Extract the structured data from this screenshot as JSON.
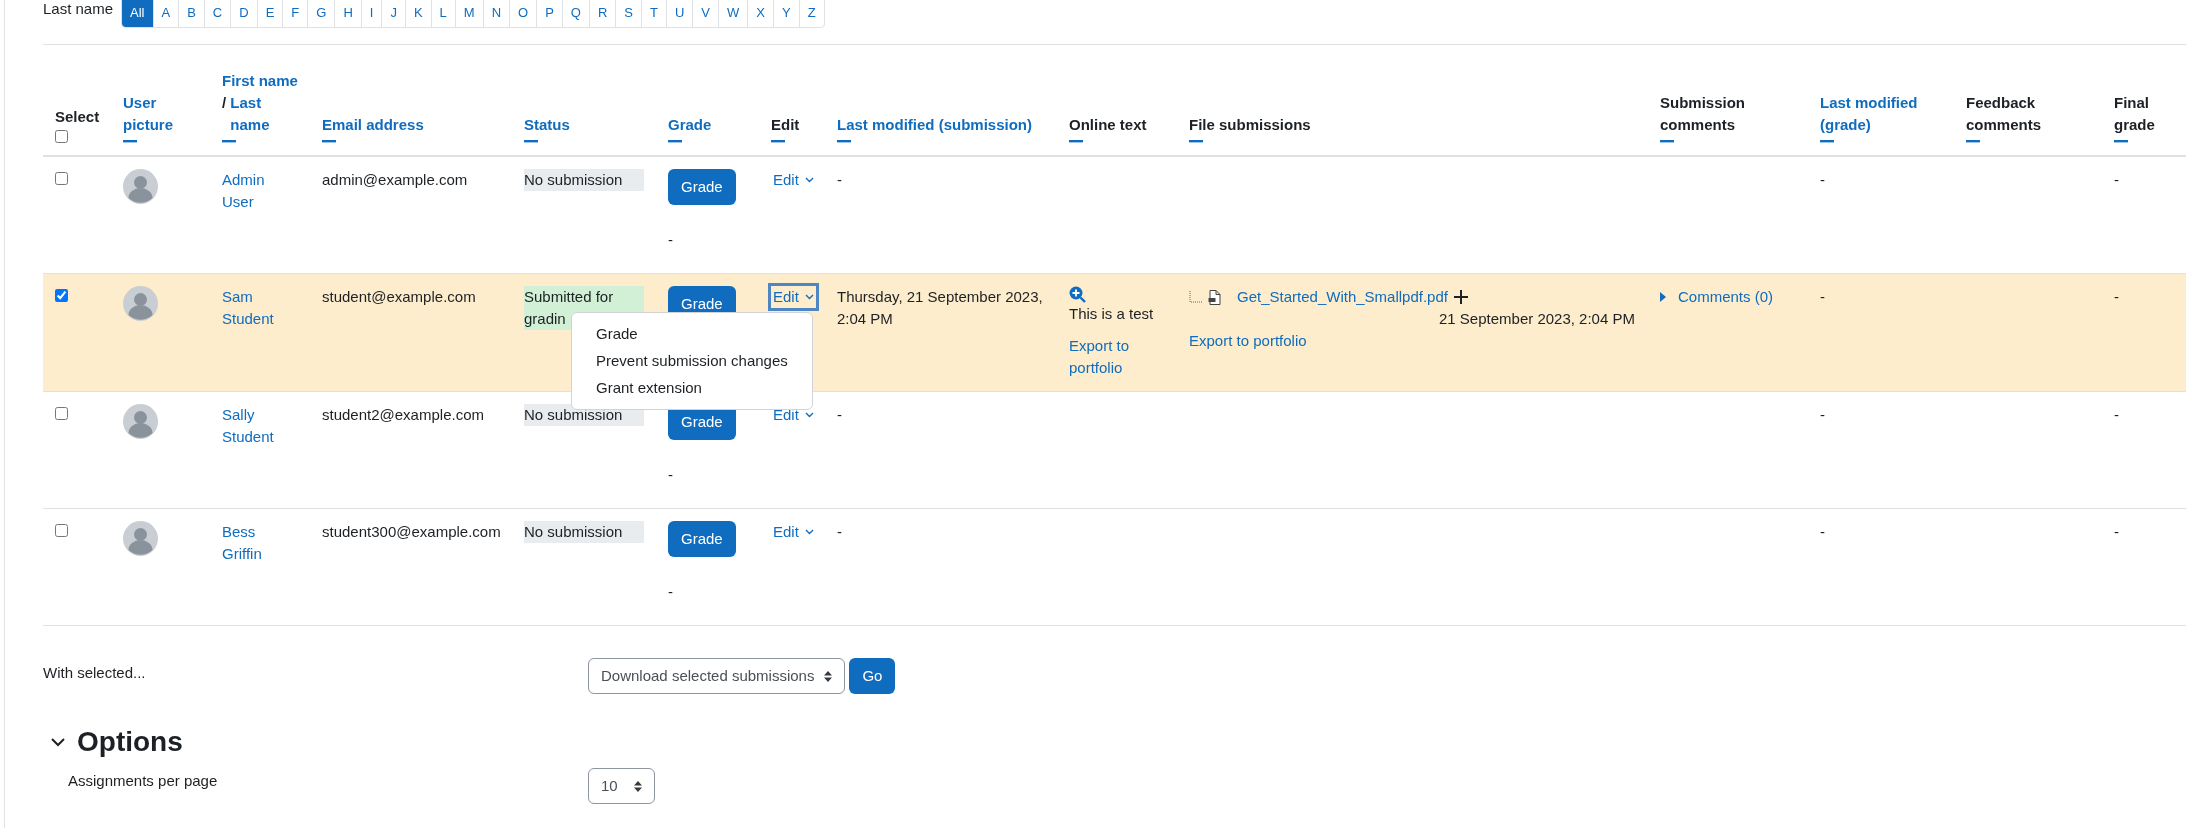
{
  "filter": {
    "label": "Last name",
    "letters": [
      {
        "label": "All",
        "selected": true
      },
      {
        "label": "A",
        "selected": false
      },
      {
        "label": "B",
        "selected": false
      },
      {
        "label": "C",
        "selected": false
      },
      {
        "label": "D",
        "selected": false
      },
      {
        "label": "E",
        "selected": false
      },
      {
        "label": "F",
        "selected": false
      },
      {
        "label": "G",
        "selected": false
      },
      {
        "label": "H",
        "selected": false
      },
      {
        "label": "I",
        "selected": false
      },
      {
        "label": "J",
        "selected": false
      },
      {
        "label": "K",
        "selected": false
      },
      {
        "label": "L",
        "selected": false
      },
      {
        "label": "M",
        "selected": false
      },
      {
        "label": "N",
        "selected": false
      },
      {
        "label": "O",
        "selected": false
      },
      {
        "label": "P",
        "selected": false
      },
      {
        "label": "Q",
        "selected": false
      },
      {
        "label": "R",
        "selected": false
      },
      {
        "label": "S",
        "selected": false
      },
      {
        "label": "T",
        "selected": false
      },
      {
        "label": "U",
        "selected": false
      },
      {
        "label": "V",
        "selected": false
      },
      {
        "label": "W",
        "selected": false
      },
      {
        "label": "X",
        "selected": false
      },
      {
        "label": "Y",
        "selected": false
      },
      {
        "label": "Z",
        "selected": false
      }
    ]
  },
  "table": {
    "select_all": {
      "checked": false
    },
    "columns": [
      {
        "kind": "select",
        "parts": [
          {
            "text": "Select",
            "link": false
          }
        ]
      },
      {
        "kind": "text",
        "parts": [
          {
            "text": "User picture",
            "link": true
          }
        ]
      },
      {
        "kind": "text",
        "parts": [
          {
            "text": "First name",
            "link": true
          },
          {
            "text": "/",
            "link": false
          },
          {
            "text": "Last name",
            "link": true
          }
        ]
      },
      {
        "kind": "text",
        "parts": [
          {
            "text": "Email address",
            "link": true
          }
        ]
      },
      {
        "kind": "text",
        "parts": [
          {
            "text": "Status",
            "link": true
          }
        ]
      },
      {
        "kind": "text",
        "parts": [
          {
            "text": "Grade",
            "link": true
          }
        ]
      },
      {
        "kind": "text",
        "parts": [
          {
            "text": "Edit",
            "link": false
          }
        ]
      },
      {
        "kind": "text",
        "parts": [
          {
            "text": "Last modified (submission)",
            "link": true
          }
        ]
      },
      {
        "kind": "text",
        "parts": [
          {
            "text": "Online text",
            "link": false
          }
        ]
      },
      {
        "kind": "text",
        "parts": [
          {
            "text": "File submissions",
            "link": false
          }
        ]
      },
      {
        "kind": "text",
        "parts": [
          {
            "text": "Submission comments",
            "link": false
          }
        ]
      },
      {
        "kind": "text",
        "parts": [
          {
            "text": "Last modified (grade)",
            "link": true
          }
        ]
      },
      {
        "kind": "text",
        "parts": [
          {
            "text": "Feedback comments",
            "link": false
          }
        ]
      },
      {
        "kind": "text",
        "parts": [
          {
            "text": "Final grade",
            "link": false
          }
        ]
      }
    ],
    "rows": [
      {
        "selected": false,
        "name": "Admin User",
        "email": "admin@example.com",
        "status": {
          "text": "No submission",
          "kind": "none"
        },
        "grade_button": "Grade",
        "grade": "-",
        "edit": {
          "label": "Edit",
          "focused": false
        },
        "last_modified": "-",
        "last_modified_grade": "-",
        "final_grade": "-"
      },
      {
        "selected": true,
        "name": "Sam Student",
        "email": "student@example.com",
        "status": {
          "text": "Submitted for gradin",
          "kind": "submitted"
        },
        "grade_button": "Grade",
        "edit": {
          "label": "Edit",
          "focused": true,
          "menu": [
            "Grade",
            "Prevent submission changes",
            "Grant extension"
          ]
        },
        "last_modified": "Thursday, 21 September 2023, 2:04 PM",
        "online_text": {
          "text": "This is a test",
          "export": "Export to portfolio"
        },
        "file": {
          "name": "Get_Started_With_Smallpdf.pdf",
          "date": "21 September 2023, 2:04 PM",
          "export": "Export to portfolio"
        },
        "comments": "Comments (0)",
        "last_modified_grade": "-",
        "final_grade": "-"
      },
      {
        "selected": false,
        "name": "Sally Student",
        "email": "student2@example.com",
        "status": {
          "text": "No submission",
          "kind": "none"
        },
        "grade_button": "Grade",
        "grade": "-",
        "edit": {
          "label": "Edit",
          "focused": false
        },
        "last_modified": "-",
        "last_modified_grade": "-",
        "final_grade": "-"
      },
      {
        "selected": false,
        "name": "Bess Griffin",
        "email": "student300@example.com",
        "status": {
          "text": "No submission",
          "kind": "none"
        },
        "grade_button": "Grade",
        "grade": "-",
        "edit": {
          "label": "Edit",
          "focused": false
        },
        "last_modified": "-",
        "last_modified_grade": "-",
        "final_grade": "-"
      }
    ]
  },
  "bulk": {
    "label": "With selected...",
    "action": "Download selected submissions",
    "button": "Go"
  },
  "options": {
    "title": "Options",
    "expanded": true,
    "fields": [
      {
        "label": "Assignments per page",
        "value": "10"
      }
    ]
  }
}
